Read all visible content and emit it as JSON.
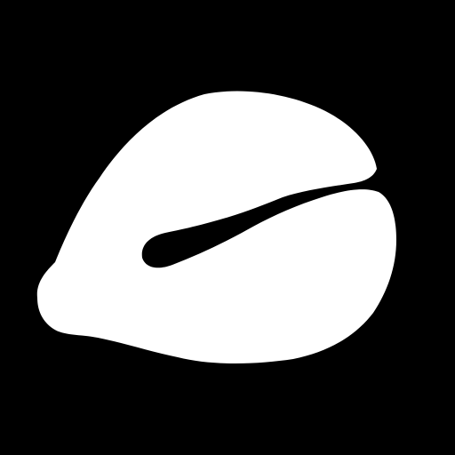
{
  "colors": {
    "background": "#000000",
    "shape_fill": "#ffffff",
    "slit_fill": "#000000"
  },
  "image": {
    "content": "mask-silhouette",
    "shape_name": "leaf-shape"
  }
}
